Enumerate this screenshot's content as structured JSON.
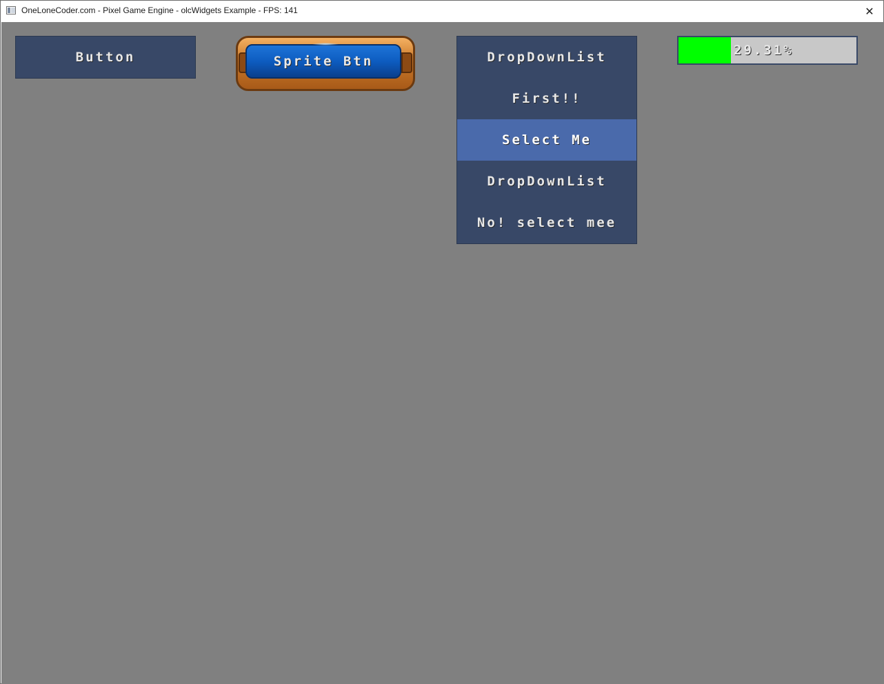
{
  "window": {
    "title": "OneLoneCoder.com - Pixel Game Engine - olcWidgets Example - FPS: 141",
    "close_glyph": "✕"
  },
  "widgets": {
    "button": {
      "label": "Button"
    },
    "sprite_button": {
      "label": "Sprite Btn"
    },
    "dropdown": {
      "items": [
        {
          "label": "DropDownList",
          "selected": false
        },
        {
          "label": "First!!",
          "selected": false
        },
        {
          "label": "Select Me",
          "selected": true
        },
        {
          "label": "DropDownList",
          "selected": false
        },
        {
          "label": "No! select mee",
          "selected": false
        }
      ]
    },
    "progress_bar": {
      "percent": 29.31,
      "label": "29.31%",
      "fill_color": "#00ff00",
      "track_color": "#c8c8c8"
    }
  },
  "colors": {
    "canvas_background": "#808080",
    "widget_background": "#384867",
    "selected_item": "#4a6aab",
    "text": "#e8e8e8"
  },
  "icons": {
    "app": "app-window-icon",
    "close": "close-icon"
  }
}
